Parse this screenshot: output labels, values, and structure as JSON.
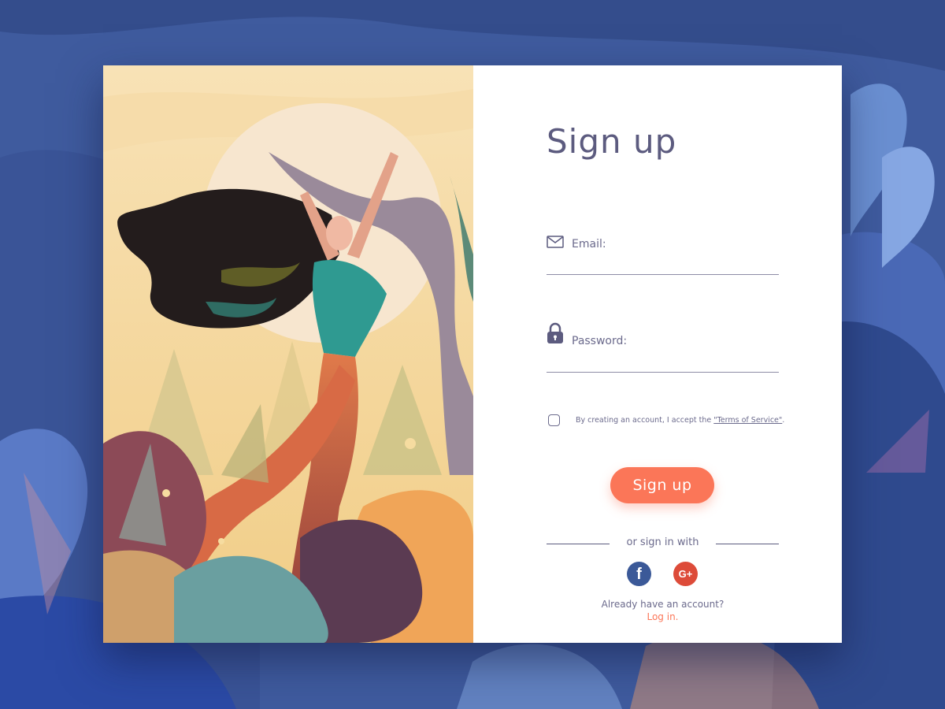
{
  "form": {
    "title": "Sign up",
    "email": {
      "label": "Email:",
      "value": "",
      "icon": "envelope-icon"
    },
    "password": {
      "label": "Password:",
      "value": "",
      "icon": "lock-icon"
    },
    "terms": {
      "checked": false,
      "text": "By creating an account, I accept the ",
      "link": "\"Terms of Service\"",
      "suffix": "."
    },
    "submit_label": "Sign up",
    "divider_text": "or sign in with",
    "social": [
      {
        "name": "facebook",
        "glyph": "f",
        "color": "#3b5998"
      },
      {
        "name": "google-plus",
        "glyph": "G+",
        "color": "#dd4b39"
      }
    ],
    "already_text": "Already have an account?",
    "login_label": "Log in."
  },
  "colors": {
    "text": "#5c5b7f",
    "accent": "#fb7658",
    "background": "#3f5b9e",
    "illustration_sky": "#f5dba0"
  }
}
